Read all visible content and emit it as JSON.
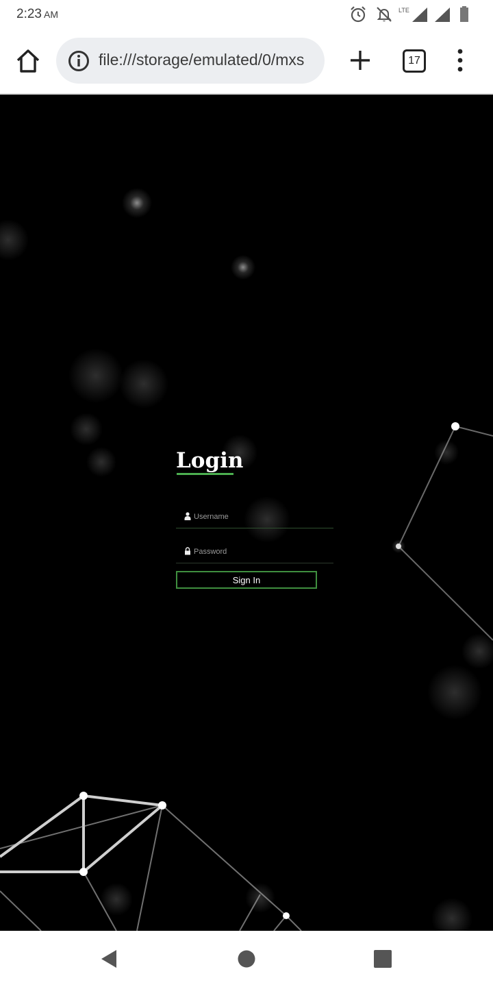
{
  "status_bar": {
    "time": "2:23",
    "ampm": "AM",
    "icons": [
      "alarm-icon",
      "notifications-off-icon",
      "lte-signal-icon",
      "signal-icon",
      "battery-icon"
    ],
    "network_label": "LTE"
  },
  "browser": {
    "url": "file:///storage/emulated/0/mxs",
    "tab_count": "17",
    "icons": [
      "home-icon",
      "info-icon",
      "plus-icon",
      "tab-switcher-icon",
      "more-vert-icon"
    ]
  },
  "login": {
    "title": "Login",
    "username_placeholder": "Username",
    "password_placeholder": "Password",
    "signin_label": "Sign In",
    "accent_color": "#4caf50"
  },
  "nav": {
    "icons": [
      "back-icon",
      "home-circle-icon",
      "recents-icon"
    ]
  }
}
